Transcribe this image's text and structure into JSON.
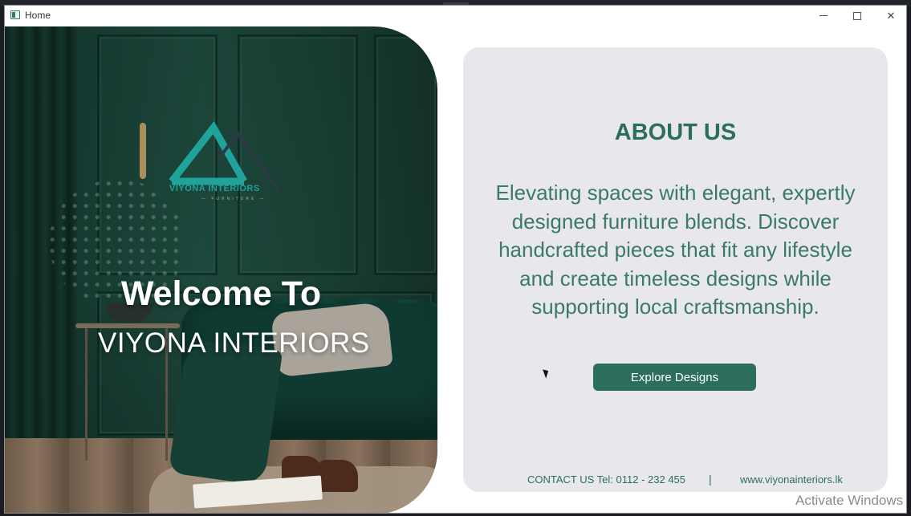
{
  "window": {
    "title": "Home",
    "controls": {
      "minimize": "minimize",
      "maximize": "maximize",
      "close": "✕"
    }
  },
  "hero": {
    "logo_text": "VIYONA INTERIORS",
    "logo_sub": "— FURNITURE —",
    "welcome": "Welcome To",
    "brand": "VIYONA INTERIORS"
  },
  "about": {
    "title": "ABOUT US",
    "body": "Elevating spaces with elegant, expertly designed furniture blends. Discover handcrafted pieces that fit any lifestyle and create timeless designs while supporting local craftsmanship.",
    "cta": "Explore Designs",
    "contact": "CONTACT US Tel: 0112 - 232 455",
    "separator": "|",
    "website": "www.viyonainteriors.lk"
  },
  "os": {
    "watermark": "Activate Windows"
  },
  "colors": {
    "accent": "#2b6e5b",
    "card_bg": "#e8e8ec",
    "logo_teal": "#1fa39a"
  }
}
